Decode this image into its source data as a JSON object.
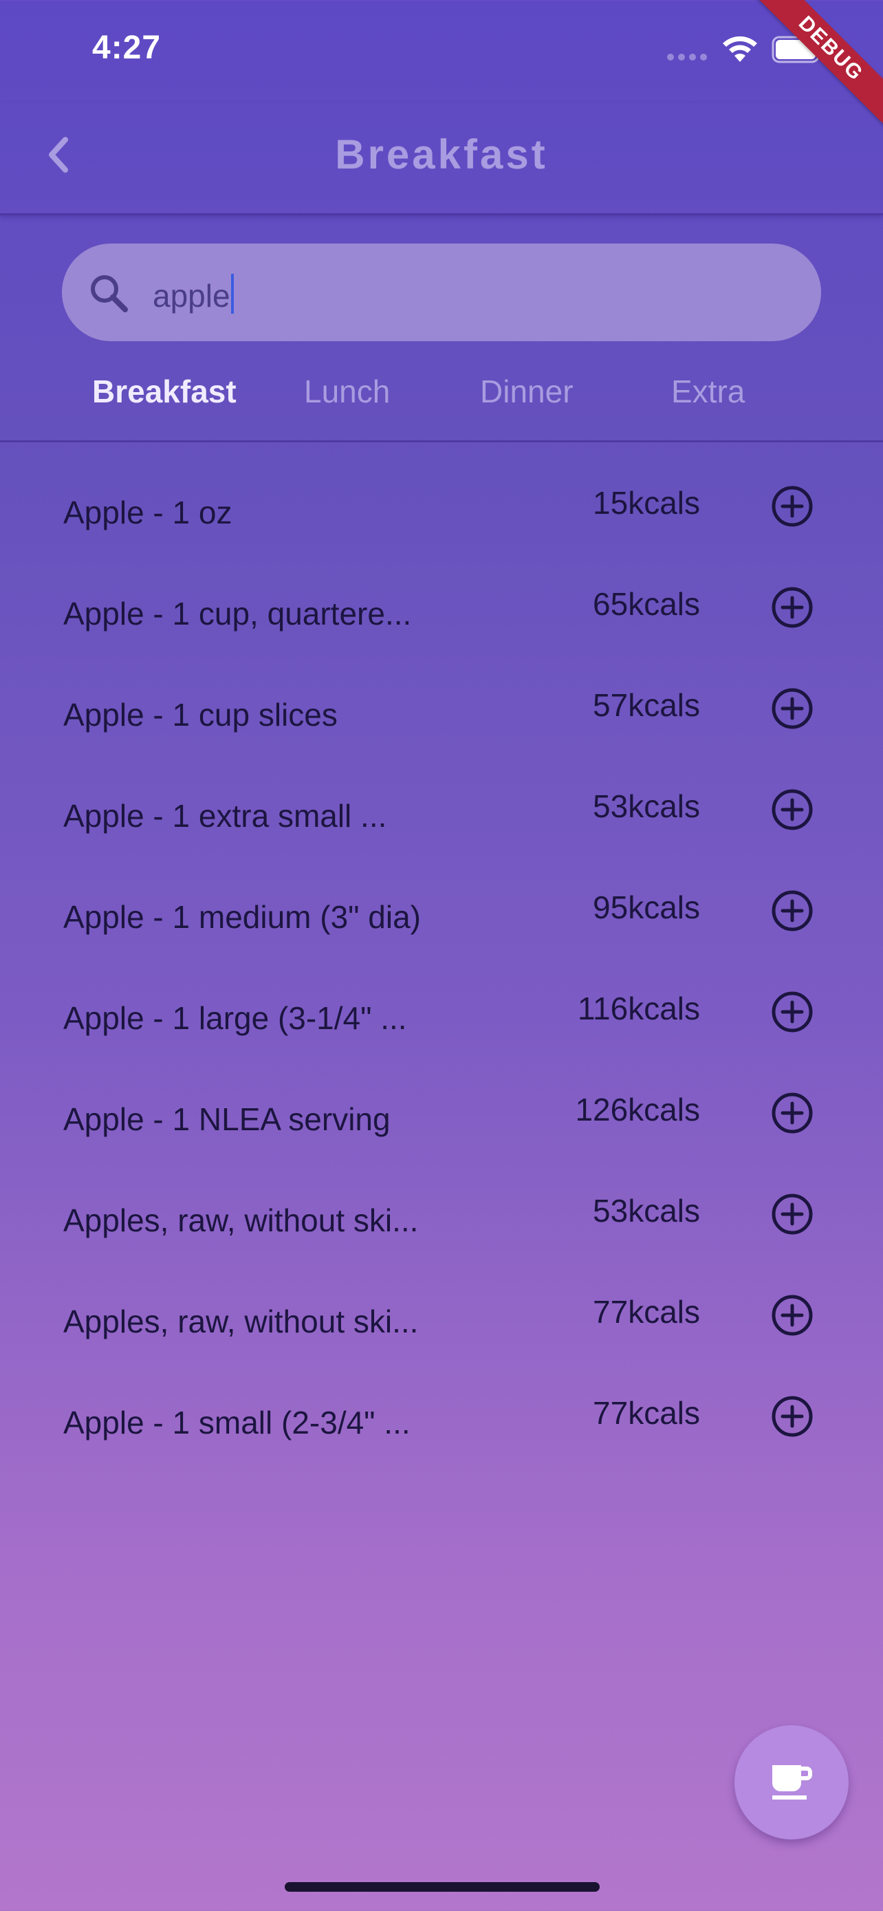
{
  "status_bar": {
    "time": "4:27"
  },
  "debug_banner": "DEBUG",
  "header": {
    "title": "Breakfast"
  },
  "search": {
    "value": "apple"
  },
  "tabs": [
    {
      "label": "Breakfast",
      "active": true
    },
    {
      "label": "Lunch",
      "active": false
    },
    {
      "label": "Dinner",
      "active": false
    },
    {
      "label": "Extra",
      "active": false
    }
  ],
  "foods": [
    {
      "name": "Apple - 1 oz",
      "kcal": "15kcals"
    },
    {
      "name": "Apple - 1 cup, quartere...",
      "kcal": "65kcals"
    },
    {
      "name": "Apple - 1 cup slices",
      "kcal": "57kcals"
    },
    {
      "name": "Apple - 1 extra small ...",
      "kcal": "53kcals"
    },
    {
      "name": "Apple - 1 medium (3\" dia)",
      "kcal": "95kcals"
    },
    {
      "name": "Apple - 1 large (3-1/4\" ...",
      "kcal": "116kcals"
    },
    {
      "name": "Apple - 1 NLEA serving",
      "kcal": "126kcals"
    },
    {
      "name": "Apples, raw, without ski...",
      "kcal": "53kcals"
    },
    {
      "name": "Apples, raw, without ski...",
      "kcal": "77kcals"
    },
    {
      "name": "Apple - 1 small (2-3/4\" ...",
      "kcal": "77kcals"
    }
  ],
  "icons": {
    "back": "chevron-left-icon",
    "search": "search-icon",
    "add": "plus-circle-icon",
    "fab": "coffee-cup-icon"
  },
  "colors": {
    "accent": "#5e49c4",
    "fab": "#b58ae0",
    "debug": "#b4233a"
  }
}
